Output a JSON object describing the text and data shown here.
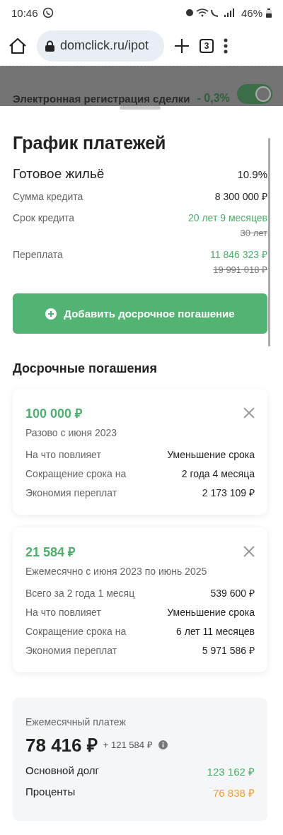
{
  "status_bar": {
    "time": "10:46",
    "battery": "46%"
  },
  "browser": {
    "url": "domclick.ru/ipot",
    "tab_count": "3"
  },
  "backdrop": {
    "label": "Электронная регистрация сделки",
    "discount": "- 0,3%",
    "toggle_on": true
  },
  "sheet": {
    "title": "График платежей",
    "program": {
      "name": "Готовое жильё",
      "rate": "10.9%"
    },
    "rows": [
      {
        "kind": "plain",
        "label": "Сумма кредита",
        "value": "8 300 000 ₽"
      },
      {
        "kind": "changed",
        "label": "Срок кредита",
        "value": "20 лет 9 месяцев",
        "old_value": "30 лет"
      },
      {
        "kind": "changed",
        "label": "Переплата",
        "value": "11 846 323 ₽",
        "old_value": "19 991 018 ₽"
      }
    ],
    "add_button": "Добавить досрочное погашение",
    "early_title": "Досрочные погашения",
    "early_payments": [
      {
        "amount": "100 000 ₽",
        "schedule": "Разово с июня 2023",
        "details": [
          {
            "label": "На что повлияет",
            "value": "Уменьшение срока"
          },
          {
            "label": "Сокращение срока на",
            "value": "2 года 4 месяца"
          },
          {
            "label": "Экономия переплат",
            "value": "2 173 109 ₽"
          }
        ]
      },
      {
        "amount": "21 584 ₽",
        "schedule": "Ежемесячно с июня 2023 по июнь 2025",
        "details": [
          {
            "label": "Всего за 2 года 1 месяц",
            "value": "539 600 ₽"
          },
          {
            "label": "На что повлияет",
            "value": "Уменьшение срока"
          },
          {
            "label": "Сокращение срока на",
            "value": "6 лет 11 месяцев"
          },
          {
            "label": "Экономия переплат",
            "value": "5 971 586 ₽"
          }
        ]
      }
    ],
    "summary": {
      "label": "Ежемесячный платеж",
      "amount": "78 416 ₽",
      "extra": "+ 121 584 ₽",
      "parts": [
        {
          "label": "Основной долг",
          "value": "123 162 ₽",
          "color": "#4caf6e"
        },
        {
          "label": "Проценты",
          "value": "76 838 ₽",
          "color": "#f0a030"
        }
      ]
    }
  }
}
